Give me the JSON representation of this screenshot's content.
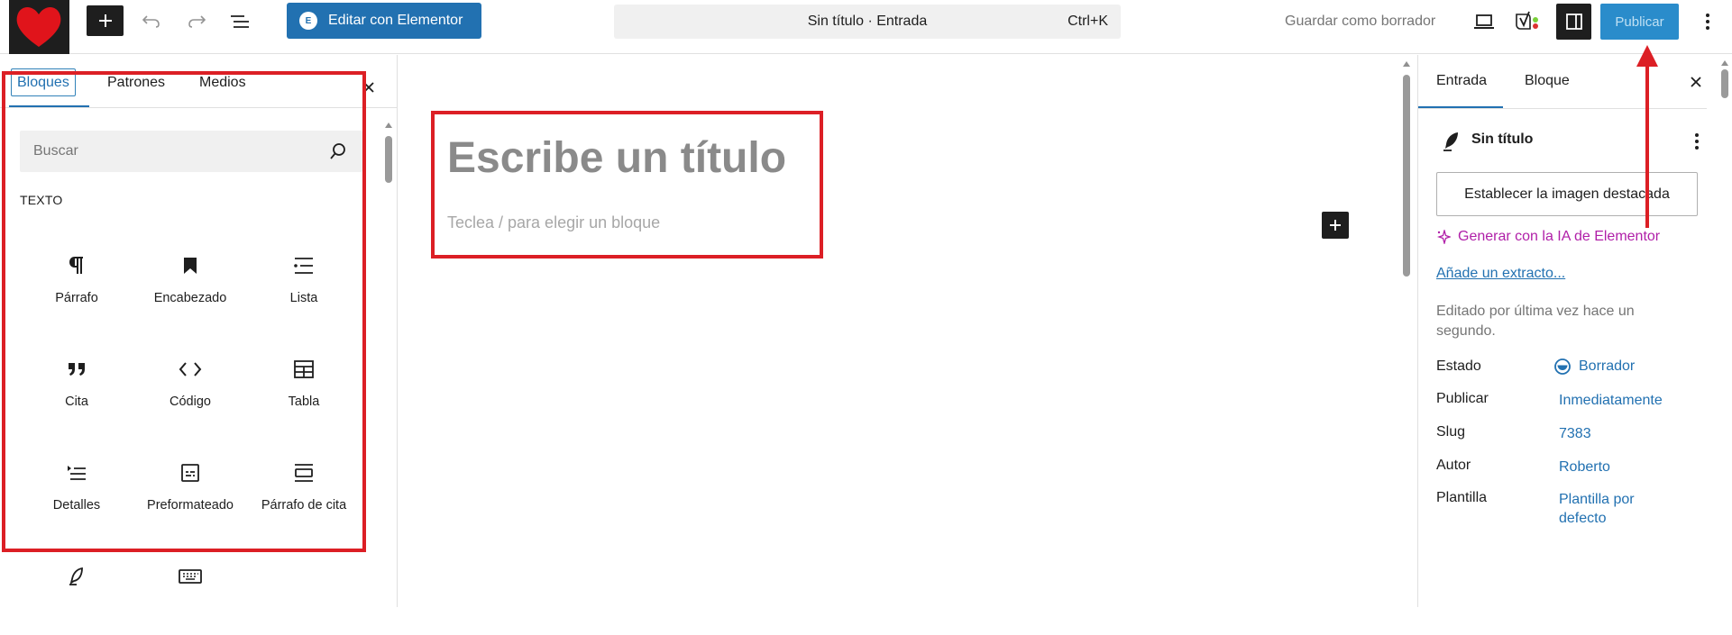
{
  "topbar": {
    "elementor_label": "Editar con Elementor",
    "document_title": "Sin título · Entrada",
    "shortcut": "Ctrl+K",
    "save_draft_label": "Guardar como borrador",
    "publish_label": "Publicar"
  },
  "inserter": {
    "tabs": [
      "Bloques",
      "Patrones",
      "Medios"
    ],
    "search_placeholder": "Buscar",
    "category": "TEXTO",
    "blocks": [
      {
        "label": "Párrafo",
        "icon": "paragraph-icon"
      },
      {
        "label": "Encabezado",
        "icon": "bookmark-icon"
      },
      {
        "label": "Lista",
        "icon": "list-icon"
      },
      {
        "label": "Cita",
        "icon": "quote-icon"
      },
      {
        "label": "Código",
        "icon": "code-icon"
      },
      {
        "label": "Tabla",
        "icon": "table-icon"
      },
      {
        "label": "Detalles",
        "icon": "details-icon"
      },
      {
        "label": "Preformateado",
        "icon": "preformatted-icon"
      },
      {
        "label": "Párrafo de cita",
        "icon": "pullquote-icon"
      },
      {
        "label": "",
        "icon": "verse-icon"
      },
      {
        "label": "",
        "icon": "keyboard-icon"
      }
    ]
  },
  "canvas": {
    "title_placeholder": "Escribe un título",
    "block_hint": "Teclea / para elegir un bloque"
  },
  "settings": {
    "tabs": [
      "Entrada",
      "Bloque"
    ],
    "doc_title": "Sin título",
    "featured_image_label": "Establecer la imagen destacada",
    "ai_label": "Generar con la IA de Elementor",
    "excerpt_label": "Añade un extracto...",
    "edited_text": "Editado por última vez hace un segundo.",
    "meta": [
      {
        "key": "Estado",
        "value": "Borrador"
      },
      {
        "key": "Publicar",
        "value": "Inmediatamente"
      },
      {
        "key": "Slug",
        "value": "7383"
      },
      {
        "key": "Autor",
        "value": "Roberto"
      },
      {
        "key": "Plantilla",
        "value": "Plantilla por defecto"
      }
    ]
  },
  "colors": {
    "accent": "#2271b1",
    "annotation_red": "#dc1f25",
    "ai_magenta": "#b01fa8"
  }
}
